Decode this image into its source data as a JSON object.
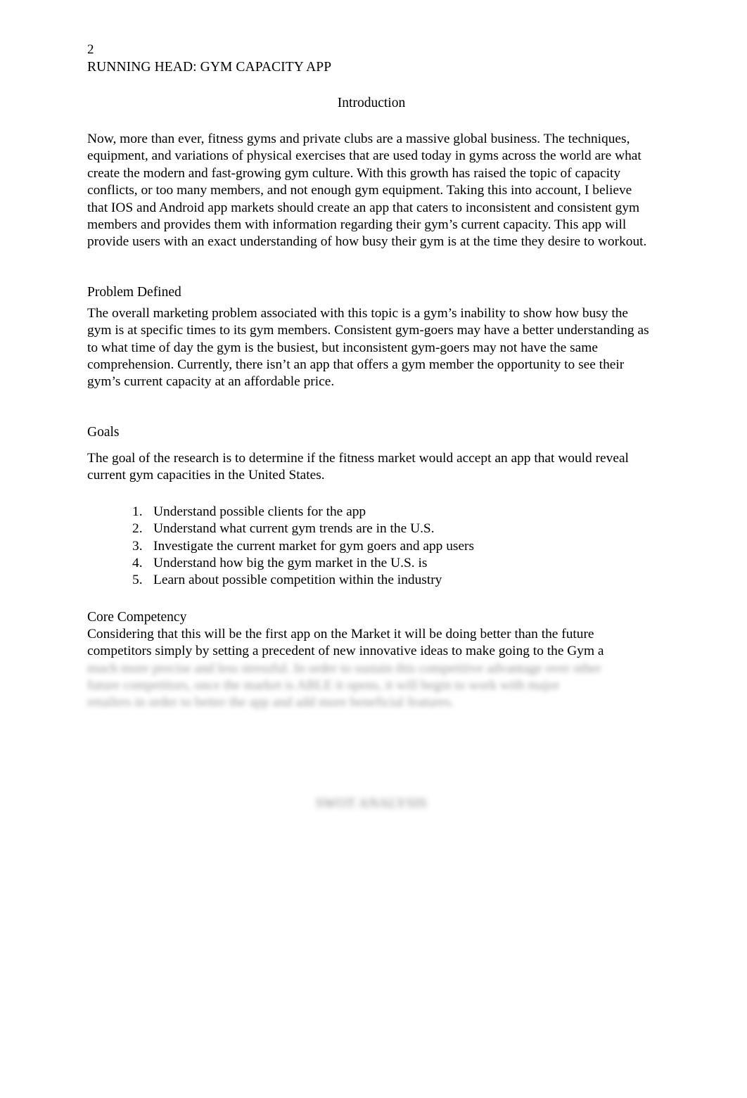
{
  "document": {
    "page_number": "2",
    "running_head": "RUNNING HEAD: GYM CAPACITY APP",
    "title": "Introduction"
  },
  "introduction": {
    "body": "Now, more than ever, fitness gyms and private clubs are a massive global business. The techniques, equipment, and variations of physical exercises that are used today in gyms across the world are what create the modern and fast-growing gym culture. With this growth has raised the topic of capacity conflicts, or too many members, and not enough gym equipment. Taking this into account, I believe that IOS and Android app markets should create an app that caters to inconsistent and consistent gym members and provides them with information regarding their gym’s current capacity. This app will provide users with an exact understanding of how busy their gym is at the time they desire to workout."
  },
  "problem_defined": {
    "heading": "Problem Defined",
    "body": "The overall marketing problem associated with this topic is a gym’s inability to show how busy the gym is at specific times to its gym members. Consistent gym-goers may have a better understanding as to what time of day the gym is the busiest, but inconsistent gym-goers may not have the same comprehension. Currently, there isn’t an app that offers a gym member the opportunity to see their gym’s current capacity at an affordable price."
  },
  "goals": {
    "heading": "Goals",
    "body": "The goal of the research is to determine if the fitness market would accept an app that would reveal current gym capacities in the United States.",
    "items": [
      "Understand possible clients for the app",
      "Understand what current gym trends are in the U.S.",
      "Investigate the current market for gym goers and app users",
      "Understand how big the gym market in the U.S. is",
      "Learn about possible competition within the industry"
    ]
  },
  "core_competency": {
    "heading": "Core Competency",
    "body_visible": "Considering that this will be the first app on the Market it will be doing better than the future competitors simply by setting a precedent of new innovative ideas to make going to the Gym a",
    "body_blurred_line_1": "much more precise and less stressful. In order to sustain this competitive advantage over other",
    "body_blurred_line_2": "future competitors, once the market is ABLE it opens, it will begin to work with major",
    "body_blurred_line_3": "retailers in order to better the app and add more beneficial features."
  },
  "next_section": {
    "heading_blurred": "SWOT ANALYSIS"
  }
}
